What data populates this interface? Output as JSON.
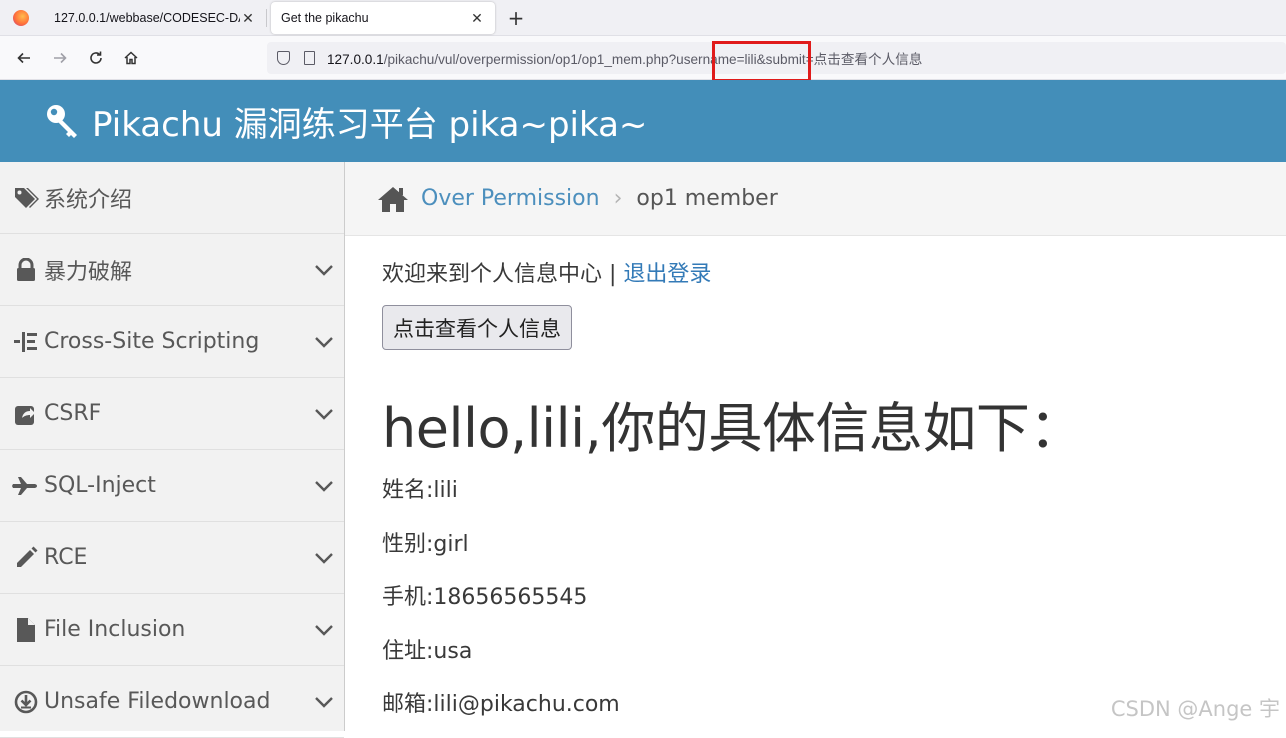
{
  "browser": {
    "tabs": [
      {
        "title": "127.0.0.1/webbase/CODESEC-DA",
        "close": "✕"
      },
      {
        "title": "Get the pikachu",
        "close": "✕"
      }
    ],
    "new_tab": "+",
    "url": {
      "host": "127.0.0.1",
      "path": "/pikachu/vul/overpermission/op1/op1_mem.php?username=lili&submit=点击查看个人信息"
    }
  },
  "header": {
    "title": "Pikachu 漏洞练习平台 pika~pika~"
  },
  "sidebar": {
    "items": [
      {
        "label": "系统介绍",
        "icon": "tag-icon",
        "has_chevron": false
      },
      {
        "label": "暴力破解",
        "icon": "lock-icon",
        "has_chevron": true
      },
      {
        "label": "Cross-Site Scripting",
        "icon": "list-icon",
        "has_chevron": true
      },
      {
        "label": "CSRF",
        "icon": "share-icon",
        "has_chevron": true
      },
      {
        "label": "SQL-Inject",
        "icon": "plane-icon",
        "has_chevron": true
      },
      {
        "label": "RCE",
        "icon": "pencil-icon",
        "has_chevron": true
      },
      {
        "label": "File Inclusion",
        "icon": "file-icon",
        "has_chevron": true
      },
      {
        "label": "Unsafe Filedownload",
        "icon": "download-icon",
        "has_chevron": true
      }
    ]
  },
  "breadcrumb": {
    "link": "Over Permission",
    "separator": "›",
    "current": "op1 member"
  },
  "main": {
    "welcome": "欢迎来到个人信息中心 | ",
    "logout": "退出登录",
    "button": "点击查看个人信息",
    "hello": "hello,lili,你的具体信息如下：",
    "info": [
      "姓名:lili",
      "性别:girl",
      "手机:18656565545",
      "住址:usa",
      "邮箱:lili@pikachu.com"
    ]
  },
  "watermark": "CSDN @Ange 宇",
  "colors": {
    "header_bg": "#438eb9",
    "link": "#4c8fbd",
    "highlight_box": "#e01b1b"
  }
}
